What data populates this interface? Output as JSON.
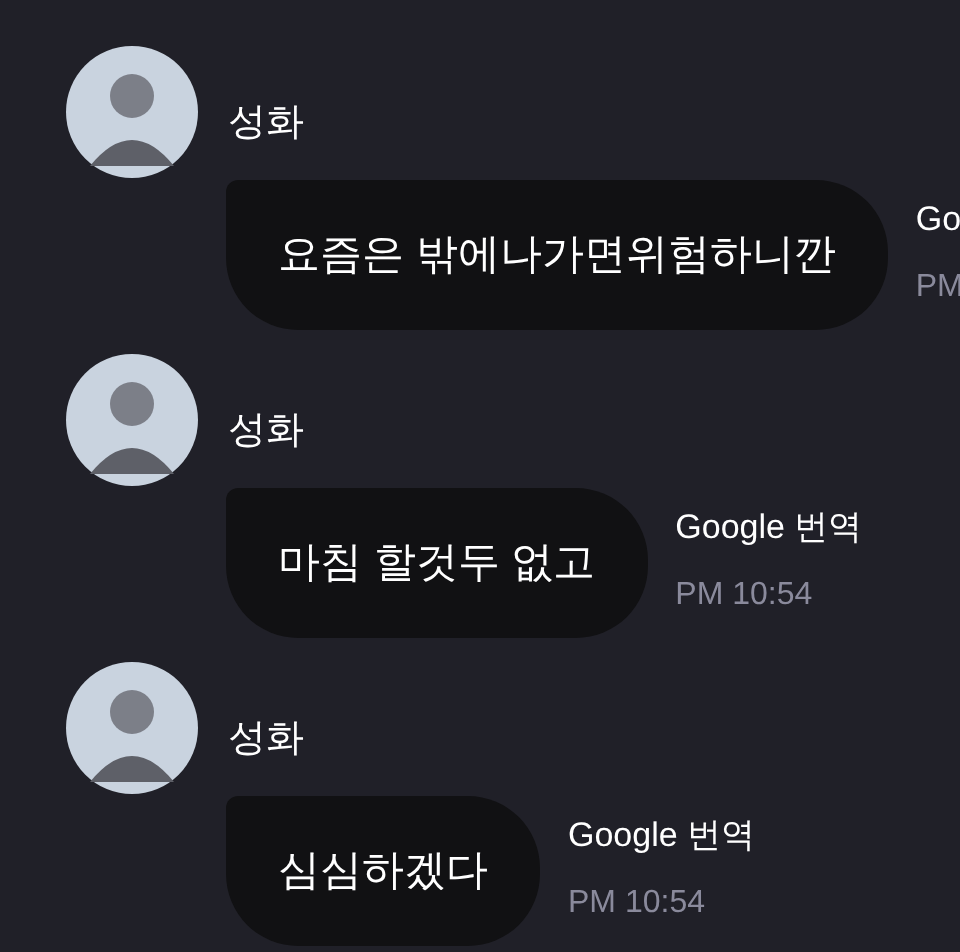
{
  "messages": [
    {
      "sender": "성화",
      "text": "요즘은 밖에나가면위험하니깐",
      "translate_label": "Go",
      "time": "PM"
    },
    {
      "sender": "성화",
      "text": "마침 할것두 없고",
      "translate_label": "Google 번역",
      "time": "PM 10:54"
    },
    {
      "sender": "성화",
      "text": "심심하겠다",
      "translate_label": "Google 번역",
      "time": "PM 10:54"
    }
  ]
}
